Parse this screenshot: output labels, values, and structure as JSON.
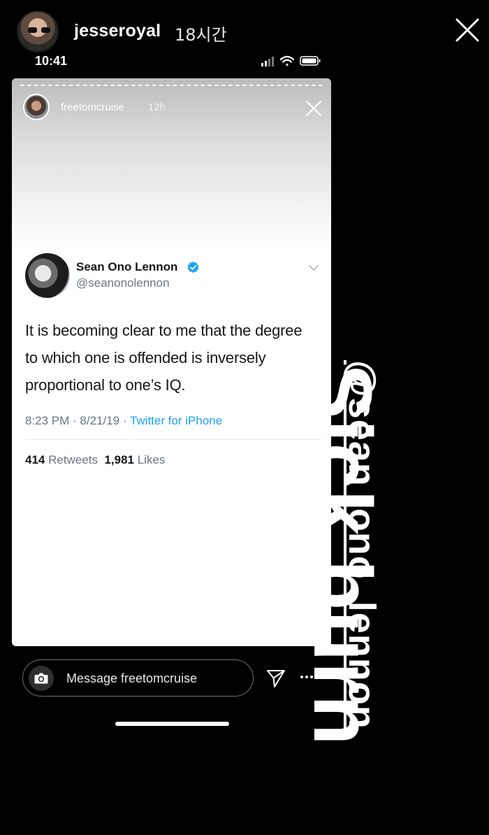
{
  "story": {
    "username": "jesseroyal",
    "time_ago": "18시간"
  },
  "screenshot": {
    "status_time": "10:41",
    "story": {
      "username": "freetomcruise",
      "time_ago": "12h"
    },
    "tweet": {
      "name": "Sean Ono Lennon",
      "handle": "@seanonolennon",
      "text": "It is becoming clear to me that the degree to which one is offended is inversely proportional to one’s IQ.",
      "time": "8:23 PM · 8/21/19 · ",
      "source": "Twitter for iPhone",
      "retweets_count": "414",
      "retweets_label": "Retweets",
      "likes_count": "1,981",
      "likes_label": "Likes"
    },
    "message_placeholder": "Message freetomcruise"
  },
  "overlay": {
    "caption": "Sick burn",
    "mention": "@sean_ono_lennon"
  },
  "colors": {
    "twitter_blue": "#1da1f2",
    "muted_gray": "#657786"
  }
}
